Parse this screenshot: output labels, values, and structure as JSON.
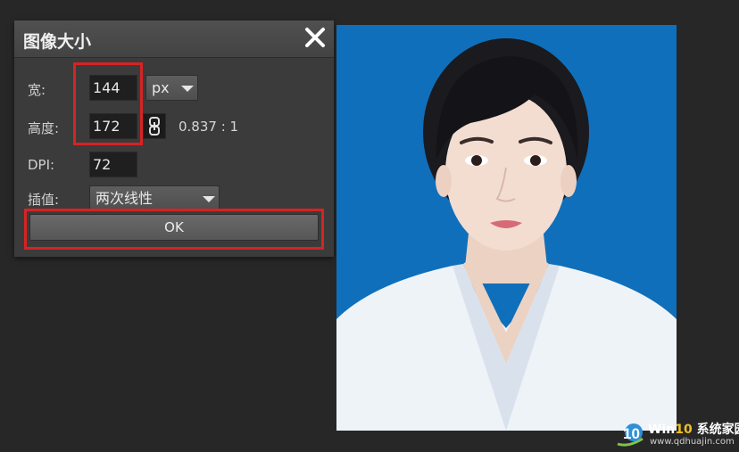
{
  "dialog": {
    "title": "图像大小",
    "width_label": "宽:",
    "width_value": "144",
    "unit_selected": "px",
    "height_label": "高度:",
    "height_value": "172",
    "aspect_ratio": "0.837 : 1",
    "dpi_label": "DPI:",
    "dpi_value": "72",
    "interp_label": "插值:",
    "interp_selected": "两次线性",
    "ok_label": "OK"
  },
  "watermark": {
    "brand_prefix": "Win",
    "brand_num": "10",
    "brand_suffix": " 系统家园",
    "url": "www.qdhuajin.com",
    "logo_text": "10"
  },
  "colors": {
    "dialog_bg": "#3b3b3b",
    "highlight": "#d62323",
    "photo_bg": "#0f6fba"
  },
  "icons": [
    "close-icon",
    "link-icon",
    "chevron-down-icon",
    "win10-logo-icon"
  ]
}
